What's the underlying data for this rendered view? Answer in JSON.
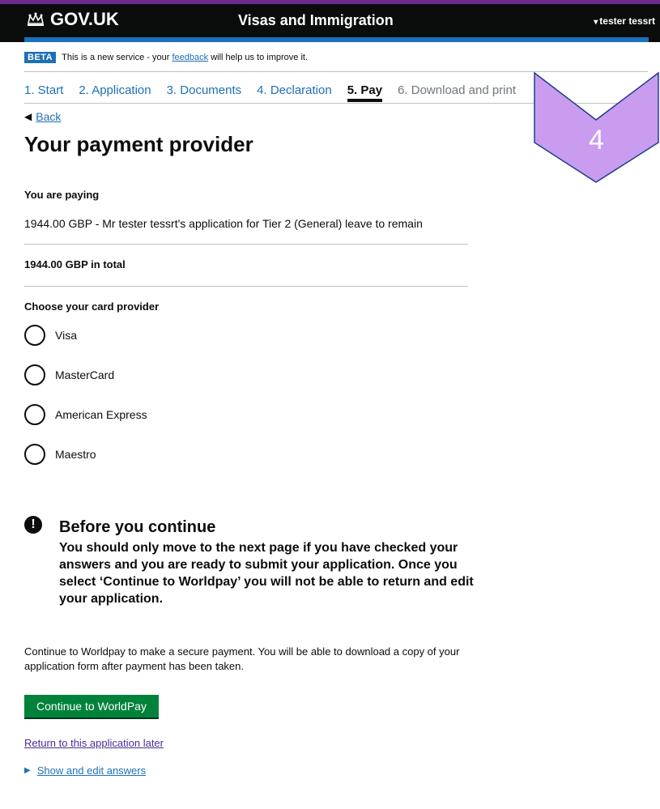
{
  "header": {
    "logo_text": "GOV.UK",
    "service_name": "Visas and Immigration",
    "user_name": "tester tessrt",
    "user_caret": "▾",
    "colors": {
      "bar": "#0b0c0c",
      "accent": "#6b2c91",
      "blue_stripe": "#1d70b8"
    }
  },
  "beta_banner": {
    "tag": "BETA",
    "text_before": "This is a new service - your ",
    "link": "feedback",
    "text_after": " will help us to improve it."
  },
  "steps": [
    {
      "label": "1. Start",
      "state": "done"
    },
    {
      "label": "2. Application",
      "state": "done"
    },
    {
      "label": "3. Documents",
      "state": "done"
    },
    {
      "label": "4. Declaration",
      "state": "done"
    },
    {
      "label": "5. Pay",
      "state": "active"
    },
    {
      "label": "6. Download and print",
      "state": "future"
    }
  ],
  "back_link": {
    "icon": "triangle-left-icon",
    "label": "Back"
  },
  "page_title": "Your payment provider",
  "payment": {
    "heading": "You are paying",
    "description": "1944.00 GBP - Mr tester tessrt's application for Tier 2 (General) leave to remain",
    "total": "1944.00 GBP in total"
  },
  "card_provider": {
    "heading": "Choose your card provider",
    "options": [
      "Visa",
      "MasterCard",
      "American Express",
      "Maestro"
    ]
  },
  "warning": {
    "icon": "exclamation-icon",
    "title": "Before you continue",
    "body": "You should only move to the next page if you have checked your answers and you are ready to submit your application. Once you select ‘Continue to Worldpay’ you will not be able to return and edit your application."
  },
  "info_text": "Continue to Worldpay to make a secure payment. You will be able to download a copy of your application form after payment has been taken.",
  "continue_button": {
    "label": "Continue to WorldPay",
    "color": "#00823b"
  },
  "return_later_link": "Return to this application later",
  "show_answers": {
    "icon": "triangle-right-icon",
    "label": "Show and edit answers"
  },
  "annotation_badge": {
    "number": "4",
    "color": "#c99cf0"
  }
}
